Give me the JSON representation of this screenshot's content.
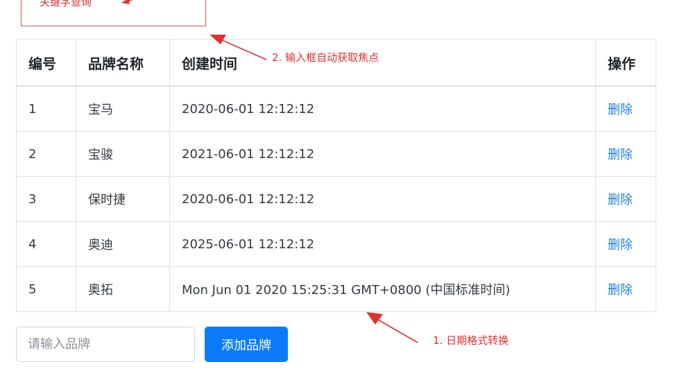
{
  "annotations": {
    "search_label": "关键字查询",
    "focus_note": "2. 输入框自动获取焦点",
    "date_note": "1. 日期格式转换",
    "color": "#e03131"
  },
  "table": {
    "headers": {
      "id": "编号",
      "name": "品牌名称",
      "time": "创建时间",
      "op": "操作"
    },
    "rows": [
      {
        "id": "1",
        "name": "宝马",
        "time": "2020-06-01 12:12:12",
        "action": "删除"
      },
      {
        "id": "2",
        "name": "宝骏",
        "time": "2021-06-01 12:12:12",
        "action": "删除"
      },
      {
        "id": "3",
        "name": "保时捷",
        "time": "2020-06-01 12:12:12",
        "action": "删除"
      },
      {
        "id": "4",
        "name": "奥迪",
        "time": "2025-06-01 12:12:12",
        "action": "删除"
      },
      {
        "id": "5",
        "name": "奥拓",
        "time": "Mon Jun 01 2020 15:25:31 GMT+0800 (中国标准时间)",
        "action": "删除"
      }
    ]
  },
  "form": {
    "input_value": "",
    "input_placeholder": "请输入品牌",
    "add_label": "添加品牌"
  },
  "colors": {
    "primary": "#0b7bfa",
    "link": "#1f7fe0",
    "border": "#dee2e6",
    "annotation": "#e03131"
  }
}
